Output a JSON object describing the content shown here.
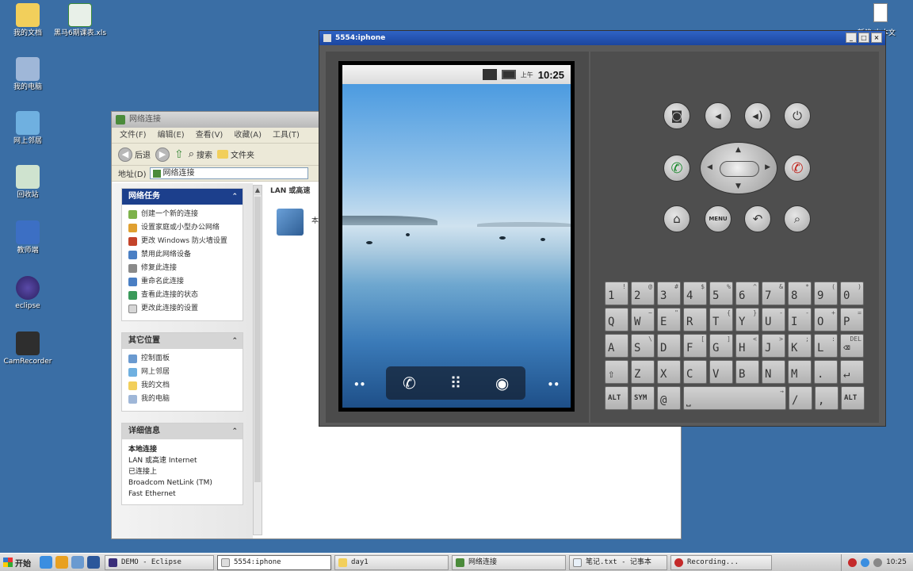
{
  "desktop": {
    "icons": [
      {
        "label": "我的文档"
      },
      {
        "label": "黑马6期课表.xls"
      },
      {
        "label": "我的电脑"
      },
      {
        "label": "网上邻居"
      },
      {
        "label": "回收站"
      },
      {
        "label": "教师端"
      },
      {
        "label": "eclipse"
      },
      {
        "label": "CamRecorder"
      }
    ],
    "corner_label": "新建 文本文档.txt"
  },
  "explorer": {
    "title": "网络连接",
    "menu": [
      "文件(F)",
      "编辑(E)",
      "查看(V)",
      "收藏(A)",
      "工具(T)"
    ],
    "toolbar": {
      "back": "后退",
      "search": "搜索",
      "folders": "文件夹"
    },
    "address_label": "地址(D)",
    "address_value": "网络连接",
    "network_tasks": {
      "title": "网络任务",
      "items": [
        "创建一个新的连接",
        "设置家庭或小型办公网络",
        "更改 Windows 防火墙设置",
        "禁用此网络设备",
        "修复此连接",
        "重命名此连接",
        "查看此连接的状态",
        "更改此连接的设置"
      ]
    },
    "other_places": {
      "title": "其它位置",
      "items": [
        "控制面板",
        "网上邻居",
        "我的文档",
        "我的电脑"
      ]
    },
    "details": {
      "title": "详细信息",
      "name": "本地连接",
      "lines": [
        "LAN 或高速 Internet",
        "已连接上",
        "Broadcom NetLink (TM)",
        "Fast Ethernet"
      ]
    },
    "content": {
      "section_header": "LAN 或高速",
      "connection_label": "本地"
    }
  },
  "emulator": {
    "title": "5554:iphone",
    "window_buttons": [
      "_",
      "□",
      "×"
    ],
    "status": {
      "ampm": "上午",
      "time": "10:25"
    },
    "dots_left": "••",
    "dots_right": "••",
    "dock": {
      "phone": "✆",
      "apps": "⠿",
      "browser": "◉"
    },
    "controls": {
      "camera": "◙",
      "vol_down": "◂",
      "vol_up": "◂)",
      "power": "⏻",
      "call": "✆",
      "end": "✆",
      "home": "⌂",
      "menu": "MENU",
      "back": "↶",
      "search": "⌕"
    },
    "dpad": {
      "up": "▲",
      "down": "▼",
      "left": "◀",
      "right": "▶"
    },
    "keyboard": [
      [
        {
          "m": "1",
          "a": "!"
        },
        {
          "m": "2",
          "a": "@"
        },
        {
          "m": "3",
          "a": "#"
        },
        {
          "m": "4",
          "a": "$"
        },
        {
          "m": "5",
          "a": "%"
        },
        {
          "m": "6",
          "a": "^"
        },
        {
          "m": "7",
          "a": "&"
        },
        {
          "m": "8",
          "a": "*"
        },
        {
          "m": "9",
          "a": "("
        },
        {
          "m": "0",
          "a": ")"
        }
      ],
      [
        {
          "m": "Q",
          "a": ""
        },
        {
          "m": "W",
          "a": "~"
        },
        {
          "m": "E",
          "a": "\""
        },
        {
          "m": "R",
          "a": ""
        },
        {
          "m": "T",
          "a": "{"
        },
        {
          "m": "Y",
          "a": "}"
        },
        {
          "m": "U",
          "a": "-"
        },
        {
          "m": "I",
          "a": "-"
        },
        {
          "m": "O",
          "a": "+"
        },
        {
          "m": "P",
          "a": "="
        }
      ],
      [
        {
          "m": "A",
          "a": ""
        },
        {
          "m": "S",
          "a": "\\"
        },
        {
          "m": "D",
          "a": ""
        },
        {
          "m": "F",
          "a": "["
        },
        {
          "m": "G",
          "a": "]"
        },
        {
          "m": "H",
          "a": "<"
        },
        {
          "m": "J",
          "a": ">"
        },
        {
          "m": "K",
          "a": ";"
        },
        {
          "m": "L",
          "a": ":"
        },
        {
          "m": "⌫",
          "a": "DEL"
        }
      ],
      [
        {
          "m": "⇧",
          "a": ""
        },
        {
          "m": "Z",
          "a": ""
        },
        {
          "m": "X",
          "a": ""
        },
        {
          "m": "C",
          "a": ""
        },
        {
          "m": "V",
          "a": ""
        },
        {
          "m": "B",
          "a": ""
        },
        {
          "m": "N",
          "a": ""
        },
        {
          "m": "M",
          "a": ""
        },
        {
          "m": ".",
          "a": ""
        },
        {
          "m": "↵",
          "a": ""
        }
      ],
      [
        {
          "m": "ALT",
          "a": ""
        },
        {
          "m": "SYM",
          "a": ""
        },
        {
          "m": "@",
          "a": ""
        },
        {
          "m": "⎵",
          "a": "→"
        },
        {
          "m": "/",
          "a": ""
        },
        {
          "m": ",",
          "a": ""
        },
        {
          "m": "ALT",
          "a": ""
        }
      ]
    ]
  },
  "taskbar": {
    "start": "开始",
    "tasks": [
      {
        "label": "DEMO - Eclipse"
      },
      {
        "label": "5554:iphone"
      },
      {
        "label": "day1"
      },
      {
        "label": "网络连接"
      },
      {
        "label": "笔记.txt - 记事本"
      },
      {
        "label": "Recording..."
      }
    ],
    "clock": "10:25"
  }
}
